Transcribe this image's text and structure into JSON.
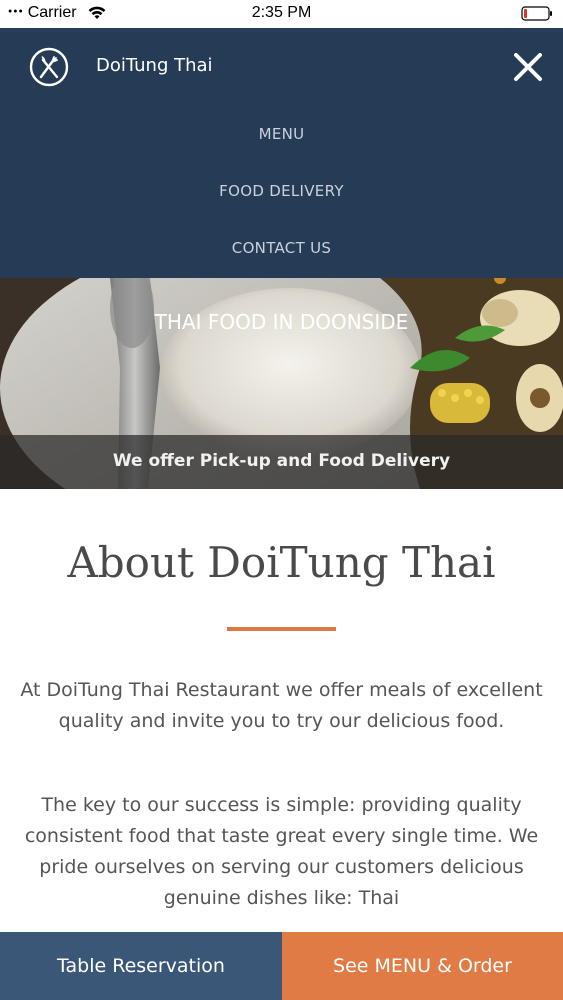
{
  "status_bar": {
    "carrier": "Carrier",
    "time": "2:35 PM"
  },
  "header": {
    "brand_name": "DoiTung Thai",
    "logo_icon": "fork-knife-icon",
    "close_icon": "close-icon"
  },
  "nav": {
    "items": [
      {
        "label": "MENU"
      },
      {
        "label": "FOOD DELIVERY"
      },
      {
        "label": "CONTACT US"
      }
    ]
  },
  "hero": {
    "title": "THAI FOOD IN DOONSIDE",
    "subtitle": "We offer Pick-up and Food Delivery"
  },
  "about": {
    "title": "About DoiTung Thai",
    "paragraph_1": "At DoiTung Thai Restaurant we offer meals of excellent quality and invite you to try our delicious food.",
    "paragraph_2": "The key to our success is simple: providing quality consistent food that taste great every single time. We pride ourselves on serving our customers delicious genuine dishes like: Thai"
  },
  "actions": {
    "reservation_label": "Table Reservation",
    "order_label": "See MENU & Order"
  },
  "colors": {
    "nav_background": "#253b56",
    "accent_orange": "#e07b45",
    "reservation_blue": "#3b5778",
    "divider": "#dd7845"
  }
}
